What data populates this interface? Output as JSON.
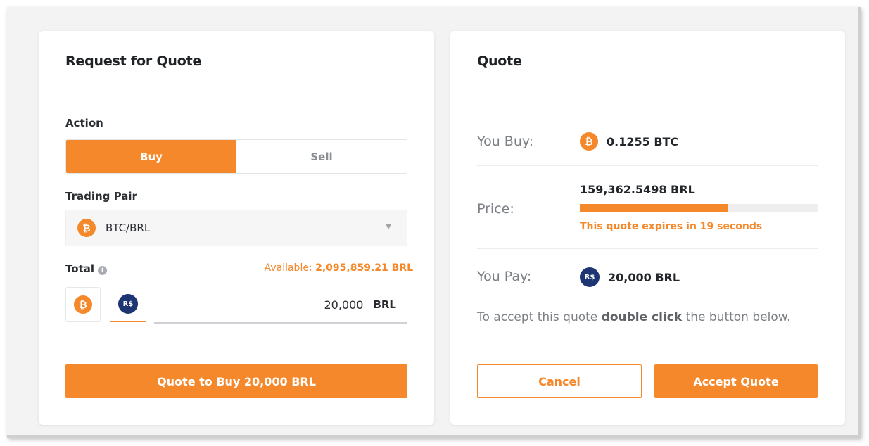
{
  "request_panel": {
    "title": "Request for Quote",
    "action_label": "Action",
    "action_options": {
      "buy": "Buy",
      "sell": "Sell"
    },
    "selected_action": "Buy",
    "trading_pair_label": "Trading Pair",
    "trading_pair_value": "BTC/BRL",
    "trading_pair_icon": "bitcoin-icon",
    "total_label": "Total",
    "info_icon": "info-icon",
    "available_label": "Available:",
    "available_amount": "2,095,859.21 BRL",
    "currency_buttons": [
      {
        "icon": "bitcoin-icon",
        "glyph": "₿"
      },
      {
        "icon": "real-icon",
        "glyph": "R$"
      }
    ],
    "selected_currency": "BRL",
    "amount_value": "20,000",
    "amount_unit": "BRL",
    "quote_button_label": "Quote to Buy 20,000 BRL"
  },
  "quote_panel": {
    "title": "Quote",
    "you_buy_label": "You Buy:",
    "you_buy_value": "0.1255 BTC",
    "price_label": "Price:",
    "price_value": "159,362.5498 BRL",
    "expiry_progress_fraction": 0.62,
    "expiry_text": "This quote expires in 19 seconds",
    "you_pay_label": "You Pay:",
    "you_pay_value": "20,000 BRL",
    "accept_note_before": "To accept this quote ",
    "accept_note_emphasis": "double click",
    "accept_note_after": " the button below.",
    "cancel_label": "Cancel",
    "accept_label": "Accept Quote"
  },
  "colors": {
    "accent": "#f5882a",
    "brl_coin": "#1d3572",
    "muted_text": "#7c8085"
  }
}
